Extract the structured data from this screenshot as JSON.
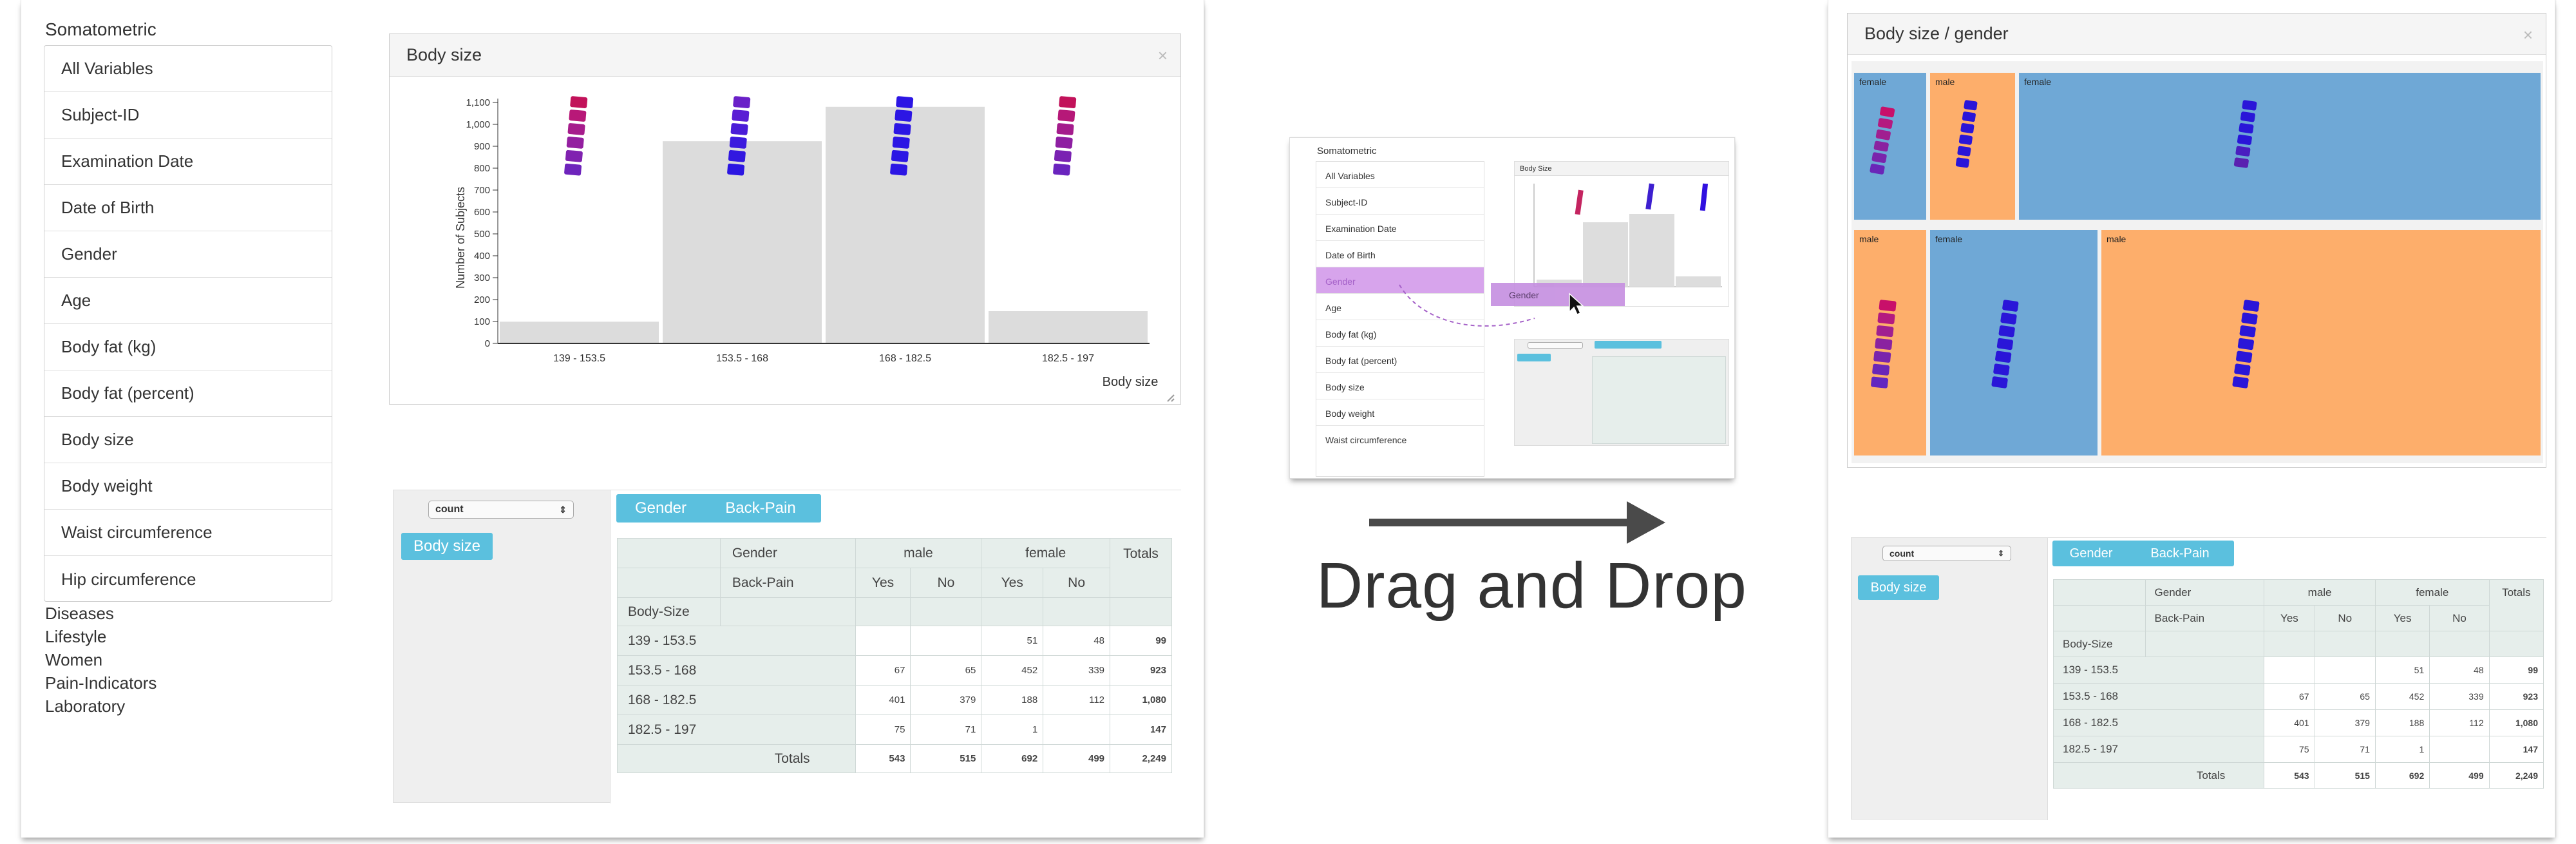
{
  "left": {
    "category": "Somatometric",
    "variables": [
      "All Variables",
      "Subject-ID",
      "Examination Date",
      "Date of Birth",
      "Gender",
      "Age",
      "Body fat (kg)",
      "Body fat (percent)",
      "Body size",
      "Body weight",
      "Waist circumference",
      "Hip circumference"
    ],
    "groups": [
      "Diseases",
      "Lifestyle",
      "Women",
      "Pain-Indicators",
      "Laboratory"
    ],
    "chart_panel": {
      "title": "Body size",
      "close": "×"
    },
    "chart_data": {
      "type": "bar",
      "categories": [
        "139 - 153.5",
        "153.5 - 168",
        "168 - 182.5",
        "182.5 - 197"
      ],
      "values": [
        99,
        923,
        1080,
        147
      ],
      "ylabel": "Number of Subjects",
      "xlabel": "Body size",
      "ylim": [
        0,
        1100
      ],
      "yticks": [
        "0",
        "100",
        "200",
        "300",
        "400",
        "500",
        "600",
        "700",
        "800",
        "900",
        "1,000",
        "1,100"
      ],
      "grid": false
    },
    "pivot": {
      "aggregator": "count",
      "col_attrs": [
        "Gender",
        "Back-Pain"
      ],
      "row_attrs": [
        "Body size"
      ]
    }
  },
  "middle": {
    "category": "Somatometric",
    "variables": [
      "All Variables",
      "Subject-ID",
      "Examination Date",
      "Date of Birth",
      "Gender",
      "Age",
      "Body fat (kg)",
      "Body fat (percent)",
      "Body size",
      "Body weight",
      "Waist circumference"
    ],
    "panel_title": "Body Size",
    "drag_label": "Gender",
    "caption": "Drag and Drop"
  },
  "right": {
    "panel_title": "Body size / gender",
    "close": "×",
    "tiles": [
      {
        "label": "female",
        "color": "#6fa8d6"
      },
      {
        "label": "male",
        "color": "#fdae6b"
      },
      {
        "label": "female",
        "color": "#6fa8d6"
      },
      {
        "label": "male",
        "color": "#fdae6b"
      },
      {
        "label": "female",
        "color": "#6fa8d6"
      },
      {
        "label": "male",
        "color": "#fdae6b"
      }
    ],
    "pivot": {
      "aggregator": "count",
      "col_attrs": [
        "Gender",
        "Back-Pain"
      ],
      "row_attrs": [
        "Body size"
      ]
    }
  },
  "table": {
    "h_gender": "Gender",
    "h_backpain": "Back-Pain",
    "h_bodysize": "Body-Size",
    "h_male": "male",
    "h_female": "female",
    "h_totals": "Totals",
    "yes": "Yes",
    "no": "No",
    "rows": [
      {
        "label": "139 - 153.5",
        "m_yes": "",
        "m_no": "",
        "f_yes": "51",
        "f_no": "48",
        "total": "99"
      },
      {
        "label": "153.5 - 168",
        "m_yes": "67",
        "m_no": "65",
        "f_yes": "452",
        "f_no": "339",
        "total": "923"
      },
      {
        "label": "168 - 182.5",
        "m_yes": "401",
        "m_no": "379",
        "f_yes": "188",
        "f_no": "112",
        "total": "1,080"
      },
      {
        "label": "182.5 - 197",
        "m_yes": "75",
        "m_no": "71",
        "f_yes": "1",
        "f_no": "",
        "total": "147"
      }
    ],
    "totals": {
      "label": "Totals",
      "m_yes": "543",
      "m_no": "515",
      "f_yes": "692",
      "f_no": "499",
      "total": "2,249"
    }
  }
}
